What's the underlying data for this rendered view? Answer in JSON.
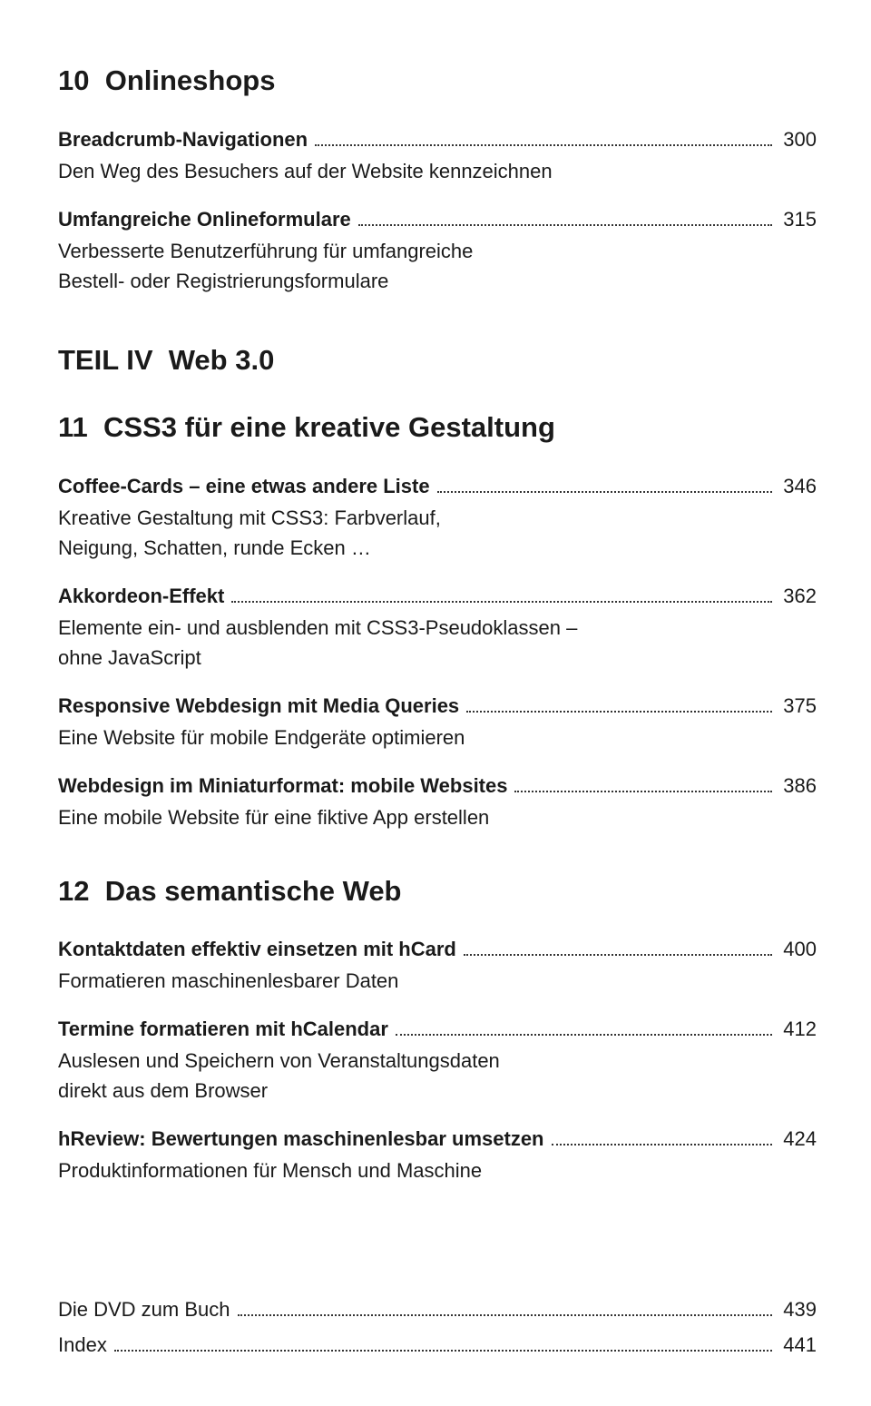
{
  "chapter10": {
    "heading": "10  Onlineshops",
    "items": [
      {
        "title": "Breadcrumb-Navigationen",
        "page": "300",
        "desc": "Den Weg des Besuchers auf der Website kennzeichnen"
      },
      {
        "title": "Umfangreiche Onlineformulare",
        "page": "315",
        "desc": "Verbesserte Benutzerführung für umfangreiche\nBestell- oder Registrierungsformulare"
      }
    ]
  },
  "part": {
    "heading": "TEIL IV  Web 3.0"
  },
  "chapter11": {
    "heading": "11  CSS3 für eine kreative Gestaltung",
    "items": [
      {
        "title": "Coffee-Cards – eine etwas andere Liste",
        "page": "346",
        "desc": "Kreative Gestaltung mit CSS3: Farbverlauf,\nNeigung, Schatten, runde Ecken …"
      },
      {
        "title": "Akkordeon-Effekt",
        "page": "362",
        "desc": "Elemente ein- und ausblenden mit CSS3-Pseudoklassen –\nohne JavaScript"
      },
      {
        "title": "Responsive Webdesign mit Media Queries",
        "page": "375",
        "desc": "Eine Website für mobile Endgeräte optimieren"
      },
      {
        "title": "Webdesign im Miniaturformat: mobile Websites",
        "page": "386",
        "desc": "Eine mobile Website für eine fiktive App erstellen"
      }
    ]
  },
  "chapter12": {
    "heading": "12  Das semantische Web",
    "items": [
      {
        "title": "Kontaktdaten effektiv einsetzen mit hCard",
        "page": "400",
        "desc": "Formatieren maschinenlesbarer Daten"
      },
      {
        "title": "Termine formatieren mit hCalendar",
        "page": "412",
        "desc": "Auslesen und Speichern von Veranstaltungsdaten\ndirekt aus dem Browser"
      },
      {
        "title": "hReview: Bewertungen maschinenlesbar umsetzen",
        "page": "424",
        "desc": "Produktinformationen für Mensch und Maschine"
      }
    ]
  },
  "back": {
    "items": [
      {
        "title": "Die DVD zum Buch",
        "page": "439"
      },
      {
        "title": "Index",
        "page": "441"
      }
    ]
  }
}
